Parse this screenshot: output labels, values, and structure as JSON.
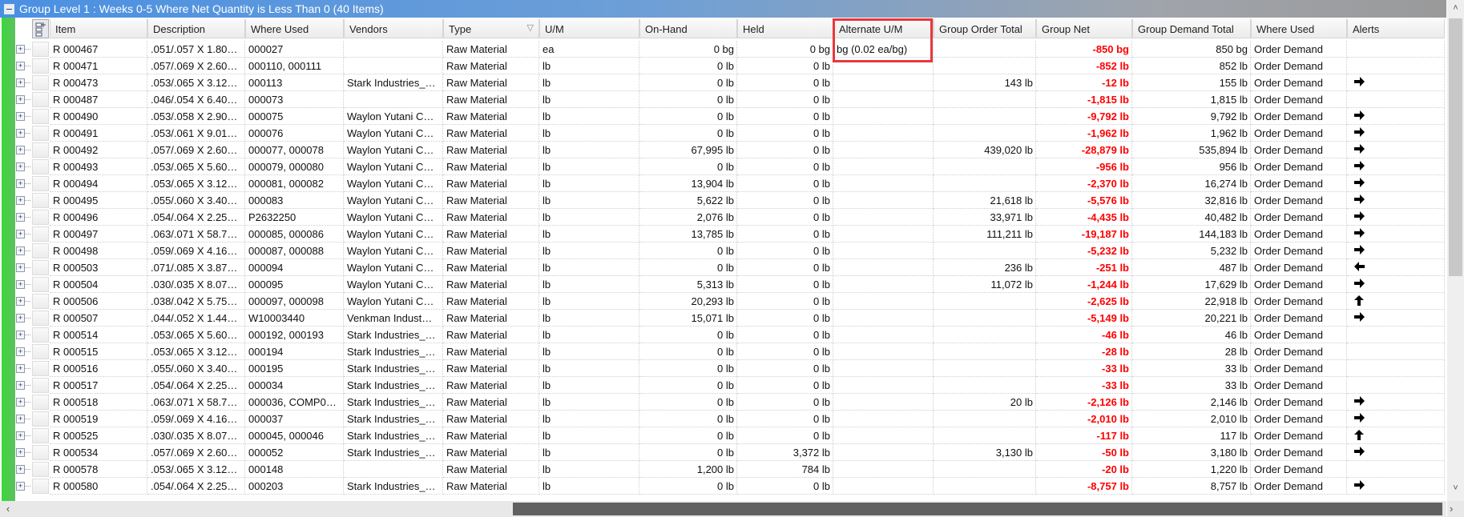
{
  "group_header": {
    "title": "Group Level 1 : Weeks 0-5 Where Net Quantity is Less Than 0 (40 Items)"
  },
  "colors": {
    "negative": "#ff0000",
    "highlight_box": "#e8373c",
    "group_bar": "#4a90e2",
    "row_indicator": "#39d839"
  },
  "columns": [
    "Item",
    "Description",
    "Where Used",
    "Vendors",
    "Type",
    "U/M",
    "On-Hand",
    "Held",
    "Alternate U/M",
    "Group Order Total",
    "Group Net",
    "Group Demand Total",
    "Where Used",
    "Alerts"
  ],
  "highlighted_column": "Alternate U/M",
  "rows": [
    [
      "R 000467",
      ".051/.057 X 1.80…",
      "000027",
      "",
      "Raw Material",
      "ea",
      "0 bg",
      "0 bg",
      "bg (0.02 ea/bg)",
      "",
      "-850 bg",
      "850 bg",
      "Order Demand",
      ""
    ],
    [
      "R 000471",
      ".057/.069 X 2.60…",
      "000110, 000111",
      "",
      "Raw Material",
      "lb",
      "0 lb",
      "0 lb",
      "",
      "",
      "-852 lb",
      "852 lb",
      "Order Demand",
      ""
    ],
    [
      "R 000473",
      ".053/.065 X 3.12…",
      "000113",
      "Stark Industries_…",
      "Raw Material",
      "lb",
      "0 lb",
      "0 lb",
      "",
      "143 lb",
      "-12 lb",
      "155 lb",
      "Order Demand",
      "right"
    ],
    [
      "R 000487",
      ".046/.054 X 6.40…",
      "000073",
      "",
      "Raw Material",
      "lb",
      "0 lb",
      "0 lb",
      "",
      "",
      "-1,815 lb",
      "1,815 lb",
      "Order Demand",
      ""
    ],
    [
      "R 000490",
      ".053/.058 X 2.90…",
      "000075",
      "Waylon Yutani C…",
      "Raw Material",
      "lb",
      "0 lb",
      "0 lb",
      "",
      "",
      "-9,792 lb",
      "9,792 lb",
      "Order Demand",
      "right"
    ],
    [
      "R 000491",
      ".053/.061 X 9.01…",
      "000076",
      "Waylon Yutani C…",
      "Raw Material",
      "lb",
      "0 lb",
      "0 lb",
      "",
      "",
      "-1,962 lb",
      "1,962 lb",
      "Order Demand",
      "right"
    ],
    [
      "R 000492",
      ".057/.069 X 2.60…",
      "000077, 000078",
      "Waylon Yutani C…",
      "Raw Material",
      "lb",
      "67,995 lb",
      "0 lb",
      "",
      "439,020 lb",
      "-28,879 lb",
      "535,894 lb",
      "Order Demand",
      "right"
    ],
    [
      "R 000493",
      ".053/.065 X 5.60…",
      "000079, 000080",
      "Waylon Yutani C…",
      "Raw Material",
      "lb",
      "0 lb",
      "0 lb",
      "",
      "",
      "-956 lb",
      "956 lb",
      "Order Demand",
      "right"
    ],
    [
      "R 000494",
      ".053/.065 X 3.12…",
      "000081, 000082",
      "Waylon Yutani C…",
      "Raw Material",
      "lb",
      "13,904 lb",
      "0 lb",
      "",
      "",
      "-2,370 lb",
      "16,274 lb",
      "Order Demand",
      "right"
    ],
    [
      "R 000495",
      ".055/.060 X 3.40…",
      "000083",
      "Waylon Yutani C…",
      "Raw Material",
      "lb",
      "5,622 lb",
      "0 lb",
      "",
      "21,618 lb",
      "-5,576 lb",
      "32,816 lb",
      "Order Demand",
      "right"
    ],
    [
      "R 000496",
      ".054/.064 X 2.25…",
      "P2632250",
      "Waylon Yutani C…",
      "Raw Material",
      "lb",
      "2,076 lb",
      "0 lb",
      "",
      "33,971 lb",
      "-4,435 lb",
      "40,482 lb",
      "Order Demand",
      "right"
    ],
    [
      "R 000497",
      ".063/.071 X 58.7…",
      "000085, 000086",
      "Waylon Yutani C…",
      "Raw Material",
      "lb",
      "13,785 lb",
      "0 lb",
      "",
      "111,211 lb",
      "-19,187 lb",
      "144,183 lb",
      "Order Demand",
      "right"
    ],
    [
      "R 000498",
      ".059/.069 X 4.16…",
      "000087, 000088",
      "Waylon Yutani C…",
      "Raw Material",
      "lb",
      "0 lb",
      "0 lb",
      "",
      "",
      "-5,232 lb",
      "5,232 lb",
      "Order Demand",
      "right"
    ],
    [
      "R 000503",
      ".071/.085 X 3.87…",
      "000094",
      "Waylon Yutani C…",
      "Raw Material",
      "lb",
      "0 lb",
      "0 lb",
      "",
      "236 lb",
      "-251 lb",
      "487 lb",
      "Order Demand",
      "left"
    ],
    [
      "R 000504",
      ".030/.035 X 8.07…",
      "000095",
      "Waylon Yutani C…",
      "Raw Material",
      "lb",
      "5,313 lb",
      "0 lb",
      "",
      "11,072 lb",
      "-1,244 lb",
      "17,629 lb",
      "Order Demand",
      "right"
    ],
    [
      "R 000506",
      ".038/.042 X 5.75…",
      "000097, 000098",
      "Waylon Yutani C…",
      "Raw Material",
      "lb",
      "20,293 lb",
      "0 lb",
      "",
      "",
      "-2,625 lb",
      "22,918 lb",
      "Order Demand",
      "up"
    ],
    [
      "R 000507",
      ".044/.052 X 1.44…",
      "W10003440",
      "Venkman Indust…",
      "Raw Material",
      "lb",
      "15,071 lb",
      "0 lb",
      "",
      "",
      "-5,149 lb",
      "20,221 lb",
      "Order Demand",
      "right"
    ],
    [
      "R 000514",
      ".053/.065 X 5.60…",
      "000192, 000193",
      "Stark Industries_…",
      "Raw Material",
      "lb",
      "0 lb",
      "0 lb",
      "",
      "",
      "-46 lb",
      "46 lb",
      "Order Demand",
      ""
    ],
    [
      "R 000515",
      ".053/.065 X 3.12…",
      "000194",
      "Stark Industries_…",
      "Raw Material",
      "lb",
      "0 lb",
      "0 lb",
      "",
      "",
      "-28 lb",
      "28 lb",
      "Order Demand",
      ""
    ],
    [
      "R 000516",
      ".055/.060 X 3.40…",
      "000195",
      "Stark Industries_…",
      "Raw Material",
      "lb",
      "0 lb",
      "0 lb",
      "",
      "",
      "-33 lb",
      "33 lb",
      "Order Demand",
      ""
    ],
    [
      "R 000517",
      ".054/.064 X 2.25…",
      "000034",
      "Stark Industries_…",
      "Raw Material",
      "lb",
      "0 lb",
      "0 lb",
      "",
      "",
      "-33 lb",
      "33 lb",
      "Order Demand",
      ""
    ],
    [
      "R 000518",
      ".063/.071 X 58.7…",
      "000036,  COMP0…",
      "Stark Industries_…",
      "Raw Material",
      "lb",
      "0 lb",
      "0 lb",
      "",
      "20 lb",
      "-2,126 lb",
      "2,146 lb",
      "Order Demand",
      "right"
    ],
    [
      "R 000519",
      ".059/.069 X 4.16…",
      "000037",
      "Stark Industries_…",
      "Raw Material",
      "lb",
      "0 lb",
      "0 lb",
      "",
      "",
      "-2,010 lb",
      "2,010 lb",
      "Order Demand",
      "right"
    ],
    [
      "R 000525",
      ".030/.035 X 8.07…",
      "000045, 000046",
      "Stark Industries_…",
      "Raw Material",
      "lb",
      "0 lb",
      "0 lb",
      "",
      "",
      "-117 lb",
      "117 lb",
      "Order Demand",
      "up"
    ],
    [
      "R 000534",
      ".057/.069 X 2.60…",
      "000052",
      "Stark Industries_…",
      "Raw Material",
      "lb",
      "0 lb",
      "3,372 lb",
      "",
      "3,130 lb",
      "-50 lb",
      "3,180 lb",
      "Order Demand",
      "right"
    ],
    [
      "R 000578",
      ".053/.065 X 3.12…",
      "000148",
      "",
      "Raw Material",
      "lb",
      "1,200 lb",
      "784 lb",
      "",
      "",
      "-20 lb",
      "1,220 lb",
      "Order Demand",
      ""
    ],
    [
      "R 000580",
      ".054/.064 X 2.25…",
      "000203",
      "Stark Industries_…",
      "Raw Material",
      "lb",
      "0 lb",
      "0 lb",
      "",
      "",
      "-8,757 lb",
      "8,757 lb",
      "Order Demand",
      "right"
    ]
  ],
  "scroll": {
    "vertical_position_pct": 0,
    "horizontal_position_pct": 100
  }
}
